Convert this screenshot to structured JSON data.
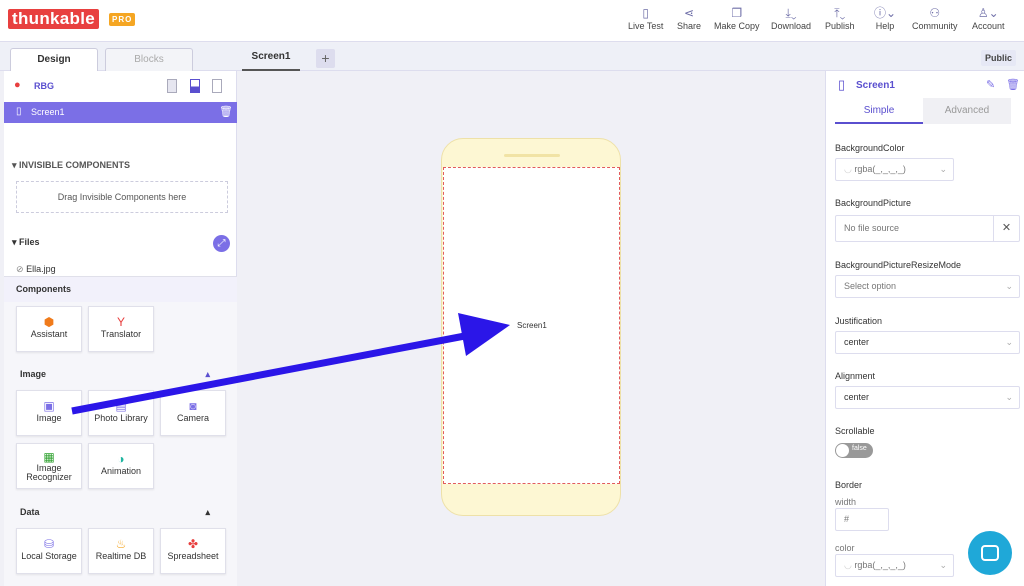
{
  "brand": {
    "name": "thunkable",
    "badge": "PRO"
  },
  "nav": [
    {
      "label": "Live Test",
      "icon": "phone-icon"
    },
    {
      "label": "Share",
      "icon": "share-icon"
    },
    {
      "label": "Make Copy",
      "icon": "copy-icon"
    },
    {
      "label": "Download",
      "icon": "download-icon"
    },
    {
      "label": "Publish",
      "icon": "publish-icon"
    },
    {
      "label": "Help",
      "icon": "help-icon"
    },
    {
      "label": "Community",
      "icon": "community-icon"
    },
    {
      "label": "Account",
      "icon": "account-icon"
    }
  ],
  "tabs": {
    "design": "Design",
    "blocks": "Blocks",
    "screen": "Screen1",
    "public": "Public"
  },
  "left": {
    "project": "RBG",
    "screen": "Screen1",
    "invisible_title": "INVISIBLE COMPONENTS",
    "invisible_drop": "Drag Invisible Components here",
    "files_title": "Files",
    "file": "Ella.jpg",
    "components_title": "Components",
    "comps_top": [
      "Assistant",
      "Translator"
    ],
    "image_title": "Image",
    "image_comps": [
      "Image",
      "Photo Library",
      "Camera"
    ],
    "image_comps2": [
      "Image Recognizer",
      "Animation"
    ],
    "data_title": "Data",
    "data_comps": [
      "Local Storage",
      "Realtime DB",
      "Spreadsheet"
    ]
  },
  "canvas": {
    "screen_label": "Screen1"
  },
  "right": {
    "title": "Screen1",
    "tab_simple": "Simple",
    "tab_advanced": "Advanced",
    "bgcolor_label": "BackgroundColor",
    "bgcolor_value": "rgba(_,_,_,_)",
    "bgpic_label": "BackgroundPicture",
    "bgpic_value": "No file source",
    "resize_label": "BackgroundPictureResizeMode",
    "resize_value": "Select option",
    "just_label": "Justification",
    "just_value": "center",
    "align_label": "Alignment",
    "align_value": "center",
    "scroll_label": "Scrollable",
    "scroll_value": "false",
    "border_label": "Border",
    "width_label": "width",
    "width_value": "#",
    "color_label": "color",
    "color_value": "rgba(_,_,_,_)"
  },
  "colors": {
    "accent": "#7b6fe6",
    "arrow": "#2b16e8",
    "logo": "#e8403f",
    "intercom": "#1fa8d8"
  }
}
